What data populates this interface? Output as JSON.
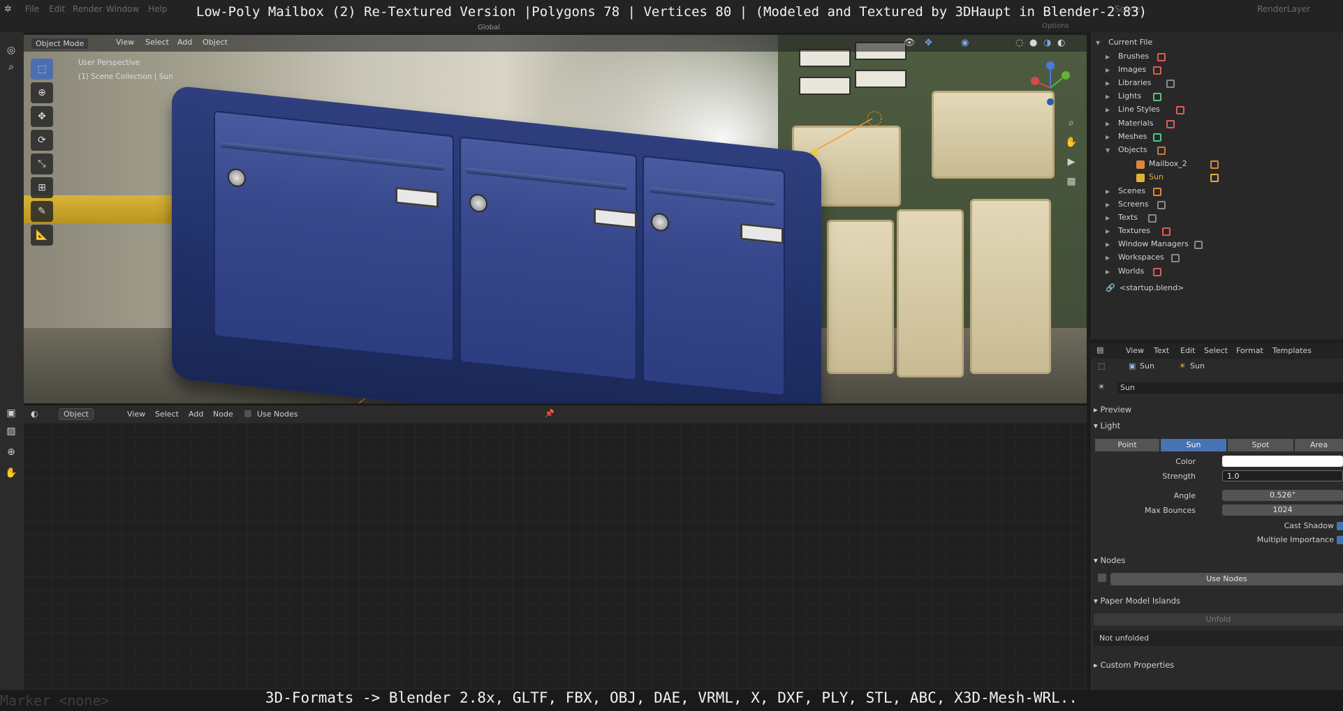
{
  "captions": {
    "top": "Low-Poly Mailbox (2) Re-Textured Version |Polygons 78 | Vertices 80 | (Modeled and Textured by 3DHaupt in Blender-2.83)",
    "bottom": "3D-Formats -> Blender 2.8x, GLTF, FBX, OBJ, DAE, VRML, X, DXF, PLY, STL, ABC, X3D-Mesh-WRL.."
  },
  "topmenu": [
    "File",
    "Edit",
    "Render",
    "Window",
    "Help"
  ],
  "topright": {
    "scene": "Scene",
    "renderlayer": "RenderLayer",
    "options": "Options"
  },
  "viewport": {
    "mode": "Object Mode",
    "menus": [
      "View",
      "Select",
      "Add",
      "Object"
    ],
    "orientation": "Global",
    "info_line1": "User Perspective",
    "info_line2": "(1) Scene Collection | Sun"
  },
  "node_editor": {
    "type": "Object",
    "menus": [
      "View",
      "Select",
      "Add",
      "Node"
    ],
    "use_nodes": "Use Nodes"
  },
  "outliner": {
    "root": "Current File",
    "items": [
      {
        "label": "Brushes",
        "color": "#e05a5a"
      },
      {
        "label": "Images",
        "color": "#e05a5a"
      },
      {
        "label": "Libraries",
        "color": "#8a8a8a"
      },
      {
        "label": "Lights",
        "color": "#5ec27a"
      },
      {
        "label": "Line Styles",
        "color": "#e05a5a"
      },
      {
        "label": "Materials",
        "color": "#e05a5a"
      },
      {
        "label": "Meshes",
        "color": "#47c98c"
      },
      {
        "label": "Objects",
        "color": "#c87a3a"
      },
      {
        "label": "Mailbox_2",
        "color": "#e0863a"
      },
      {
        "label": "Sun",
        "color": "#e0b23a"
      },
      {
        "label": "Scenes",
        "color": "#e0863a"
      },
      {
        "label": "Screens",
        "color": "#8a8a8a"
      },
      {
        "label": "Texts",
        "color": "#8a8a8a"
      },
      {
        "label": "Textures",
        "color": "#e05a5a"
      },
      {
        "label": "Window Managers",
        "color": "#8a8a8a"
      },
      {
        "label": "Workspaces",
        "color": "#8a8a8a"
      },
      {
        "label": "Worlds",
        "color": "#e05a5a"
      }
    ],
    "file": "<startup.blend>"
  },
  "text_editor_header": {
    "menus": [
      "View",
      "Text",
      "Edit",
      "Select",
      "Format",
      "Templates"
    ]
  },
  "properties": {
    "breadcrumb_object": "Sun",
    "breadcrumb_data": "Sun",
    "datablock": "Sun",
    "panel_preview": "Preview",
    "panel_light": "Light",
    "light_types": [
      "Point",
      "Sun",
      "Spot",
      "Area"
    ],
    "active_type": "Sun",
    "color_label": "Color",
    "strength_label": "Strength",
    "strength_value": "1.0",
    "angle_label": "Angle",
    "angle_value": "0.526°",
    "max_bounces_label": "Max Bounces",
    "max_bounces_value": "1024",
    "cast_shadow": "Cast Shadow",
    "multiple_importance": "Multiple Importance",
    "panel_nodes": "Nodes",
    "use_nodes_button": "Use Nodes",
    "panel_paper": "Paper Model Islands",
    "unfold_button": "Unfold",
    "not_unfolded": "Not unfolded",
    "panel_custom": "Custom Properties"
  },
  "ghost_text": {
    "marker": "Marker <none>"
  }
}
